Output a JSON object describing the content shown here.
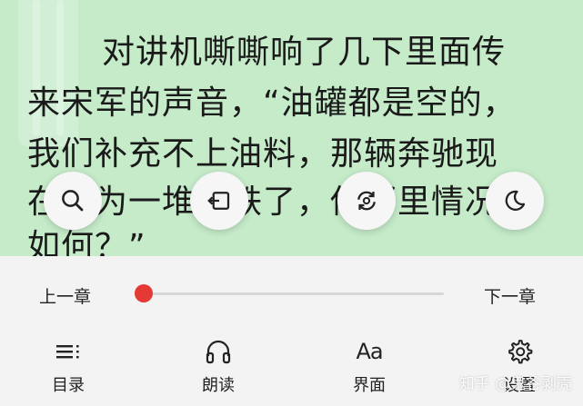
{
  "reader": {
    "lines": [
      "对讲机嘶嘶响了几下里面传",
      "来宋军的声音，“油罐都是空的，",
      "我们补充不上油料，那辆奔驰现",
      "在成为一堆废铁了，你那里情况",
      "如何？”"
    ]
  },
  "quick_actions": [
    {
      "icon": "search-icon"
    },
    {
      "icon": "exit-icon"
    },
    {
      "icon": "refresh-icon"
    },
    {
      "icon": "night-mode-icon"
    }
  ],
  "chapter_nav": {
    "prev_label": "上一章",
    "next_label": "下一章",
    "progress": 0.0
  },
  "bottom_nav": {
    "toc_label": "目录",
    "listen_label": "朗读",
    "ui_label": "界面",
    "ui_icon_text": "Aa",
    "settings_label": "设置"
  },
  "watermark": "知乎 @鬼谷剥壳",
  "colors": {
    "page_bg": "#c5ebc9",
    "menu_bg": "#f3f3f3",
    "accent": "#e53935"
  }
}
